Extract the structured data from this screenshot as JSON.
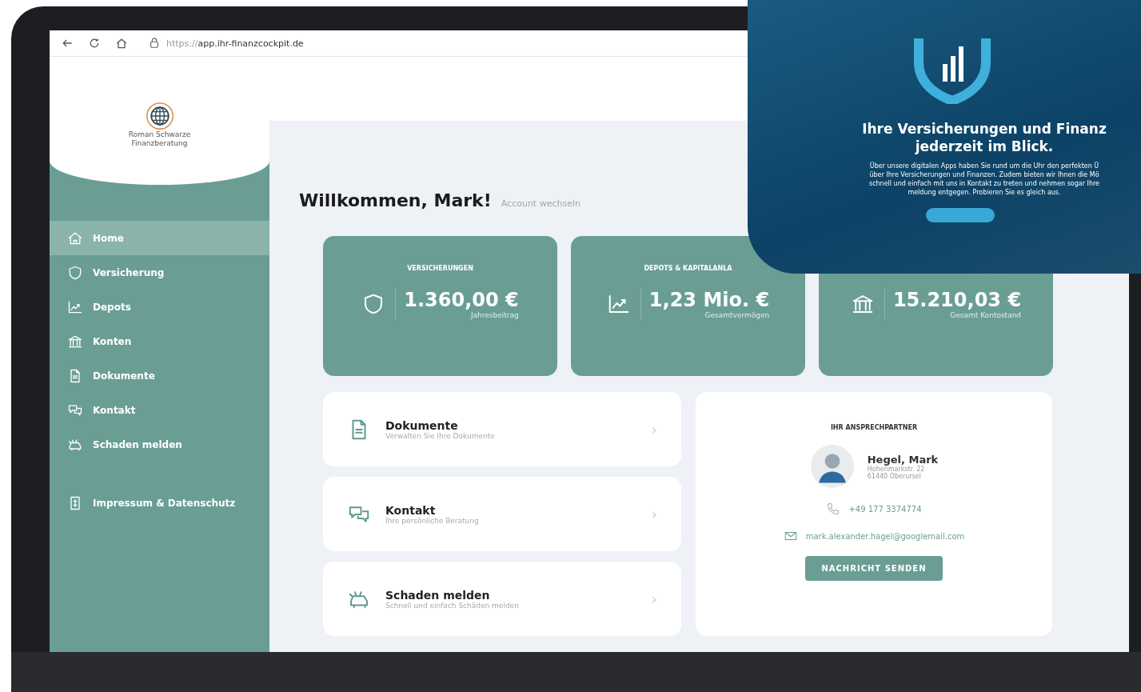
{
  "browser": {
    "url_scheme": "https://",
    "url_host": "app.ihr-finanzcockpit.de"
  },
  "logo": {
    "lines": [
      "Roman Schwarze",
      "Finanzberatung"
    ]
  },
  "nav": {
    "items": [
      {
        "label": "Home",
        "selected": true
      },
      {
        "label": "Versicherung",
        "selected": false
      },
      {
        "label": "Depots",
        "selected": false
      },
      {
        "label": "Konten",
        "selected": false
      },
      {
        "label": "Dokumente",
        "selected": false
      },
      {
        "label": "Kontakt",
        "selected": false
      },
      {
        "label": "Schaden melden",
        "selected": false
      }
    ],
    "footer_items": [
      {
        "label": "Impressum & Datenschutz",
        "selected": false
      }
    ]
  },
  "welcome": {
    "title": "Willkommen, Mark!",
    "link": "Account wechseln"
  },
  "stats": [
    {
      "title": "VERSICHERUNGEN",
      "value": "1.360,00 €",
      "caption": "Jahresbeitrag"
    },
    {
      "title": "DEPOTS & KAPITALANLA",
      "value": "1,23 Mio. €",
      "caption": "Gesamtvermögen"
    },
    {
      "value": "15.210,03 €",
      "caption": "Gesamt Kontostand"
    }
  ],
  "links": [
    {
      "title": "Dokumente",
      "subtitle": "Verwalten Sie Ihre Dokumente",
      "chevron": "›"
    },
    {
      "title": "Kontakt",
      "subtitle": "Ihre persönliche Beratung",
      "chevron": "›"
    },
    {
      "title": "Schaden melden",
      "subtitle": "Schnell und einfach Schäden melden",
      "chevron": "›"
    }
  ],
  "contact": {
    "heading": "IHR ANSPRECHPARTNER",
    "name": "Hegel, Mark",
    "address": [
      "Hohenmarkstr. 22",
      "61440 Oberursel"
    ],
    "phone": "+49 177 3374774",
    "email": "mark.alexander.hagel@googlemail.com",
    "button": "NACHRICHT SENDEN"
  },
  "promo": {
    "headline": [
      "Ihre Versicherungen und Finanz",
      "jederzeit im Blick."
    ],
    "paragraph": [
      "Über unsere digitalen Apps haben Sie rund um die Uhr den perfekten Ü",
      "über Ihre Versicherungen und Finanzen. Zudem bieten wir Ihnen die Mö",
      "schnell und einfach mit uns in Kontakt zu treten und nehmen sogar Ihre",
      "meldung entgegen. Probieren Sie es gleich aus."
    ]
  }
}
